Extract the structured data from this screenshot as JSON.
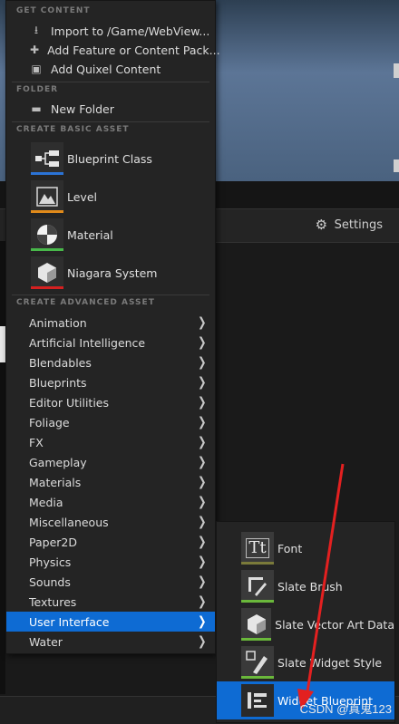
{
  "colors": {
    "accent": "#0e6bd3",
    "blueprint_bar": "#2b73d6",
    "level_bar": "#e08a1a",
    "material_bar": "#48b84a",
    "niagara_bar": "#d42020",
    "font_bar": "#7a7a3a",
    "slate_bar": "#6ab83b",
    "viewport_border": "#d9a520",
    "annotation_arrow": "#e32020"
  },
  "toolbar": {
    "settings_label": "Settings",
    "settings_icon": "gear-icon"
  },
  "menu": {
    "get_content": {
      "title": "GET CONTENT",
      "items": [
        {
          "label": "Import to /Game/WebView...",
          "icon": "import-icon"
        },
        {
          "label": "Add Feature or Content Pack...",
          "icon": "puzzle-icon"
        },
        {
          "label": "Add Quixel Content",
          "icon": "quixel-icon"
        }
      ]
    },
    "folder": {
      "title": "FOLDER",
      "items": [
        {
          "label": "New Folder",
          "icon": "new-folder-icon"
        }
      ]
    },
    "basic": {
      "title": "CREATE BASIC ASSET",
      "items": [
        {
          "label": "Blueprint Class",
          "icon": "blueprint-class-icon"
        },
        {
          "label": "Level",
          "icon": "level-icon"
        },
        {
          "label": "Material",
          "icon": "material-icon"
        },
        {
          "label": "Niagara System",
          "icon": "niagara-system-icon"
        }
      ]
    },
    "advanced": {
      "title": "CREATE ADVANCED ASSET",
      "items": [
        "Animation",
        "Artificial Intelligence",
        "Blendables",
        "Blueprints",
        "Editor Utilities",
        "Foliage",
        "FX",
        "Gameplay",
        "Materials",
        "Media",
        "Miscellaneous",
        "Paper2D",
        "Physics",
        "Sounds",
        "Textures",
        "User Interface",
        "Water"
      ],
      "active": "User Interface"
    }
  },
  "submenu": {
    "items": [
      {
        "label": "Font",
        "icon": "font-icon"
      },
      {
        "label": "Slate Brush",
        "icon": "slate-brush-icon"
      },
      {
        "label": "Slate Vector Art Data",
        "icon": "slate-vector-art-icon"
      },
      {
        "label": "Slate Widget Style",
        "icon": "slate-widget-style-icon"
      },
      {
        "label": "Widget Blueprint",
        "icon": "widget-blueprint-icon"
      }
    ],
    "active": "Widget Blueprint"
  },
  "watermark": "CSDN @真鬼123"
}
